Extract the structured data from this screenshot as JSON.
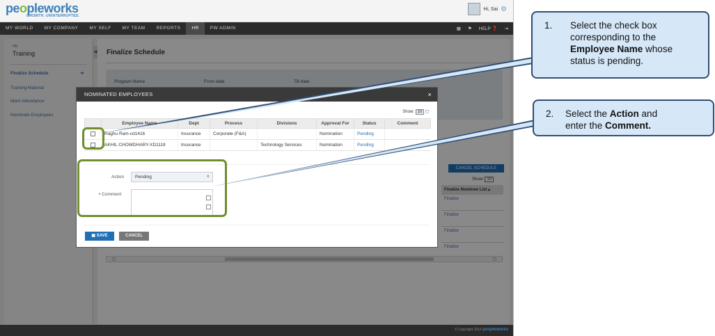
{
  "header": {
    "logo_left": "pe",
    "logo_o": "o",
    "logo_right": "pleworks",
    "tagline": "GROWTH. UNINTERRUPTED.",
    "greeting": "Hi, Sai"
  },
  "nav": {
    "items": [
      "MY WORLD",
      "MY COMPANY",
      "MY SELF",
      "MY TEAM",
      "REPORTS",
      "HR",
      "PW ADMIN"
    ],
    "active": "HR",
    "help": "HELP"
  },
  "sidebar": {
    "section": "HR",
    "module": "Training",
    "items": [
      {
        "label": "Finalize Schedule"
      },
      {
        "label": "Training Material"
      },
      {
        "label": "Mark Attendance"
      },
      {
        "label": "Nominate Employees"
      }
    ]
  },
  "main": {
    "title": "Finalize Schedule",
    "filter_labels": [
      "Program Name",
      "From date",
      "Till date"
    ],
    "cancel_schedule": "CANCEL SCHEDULE",
    "show_label": "Show:",
    "show_value": "10",
    "finalize_header": "Finalize Nominee List",
    "finalize_links": [
      "Finalize",
      "Finalize",
      "Finalize",
      "Finalize"
    ]
  },
  "modal": {
    "title": "NOMINATED EMPLOYEES",
    "close": "×",
    "show_label": "Show:",
    "show_value": "10",
    "columns": [
      "",
      "Employee Name",
      "Dept",
      "Process",
      "Divisions",
      "Approval For",
      "Status",
      "Comment"
    ],
    "rows": [
      {
        "name": "Raghu Ram-cd1416",
        "dept": "Insurance",
        "process": "Corporate (F&A)",
        "division": "",
        "approval": "Nomination",
        "status": "Pending",
        "comment": ""
      },
      {
        "name": "AKHIL CHOWDHARY-XD1119",
        "dept": "Insurance",
        "process": "",
        "division": "Technology Services",
        "approval": "Nomination",
        "status": "Pending",
        "comment": ""
      }
    ],
    "action_label": "Action",
    "action_value": "Pending",
    "comment_label": "Comment",
    "required_mark": "•",
    "save": "SAVE",
    "cancel": "CANCEL"
  },
  "footer": {
    "copyright": "© Copyright 2014",
    "brand": "peopleworks"
  },
  "callouts": [
    {
      "num": "1.",
      "lines": [
        "Select the check box",
        "corresponding to the"
      ],
      "bold": "Employee Name",
      "after": " whose",
      "last": "status is pending."
    },
    {
      "num": "2.",
      "pre": "Select the ",
      "bold1": "Action",
      "mid": "  and",
      "line2_pre": "enter the ",
      "bold2": "Comment."
    }
  ],
  "colors": {
    "accent": "#1f6fb5",
    "highlight": "#6e8f2a",
    "callout_bg": "#d6e7f7",
    "callout_border": "#2f4d73"
  }
}
